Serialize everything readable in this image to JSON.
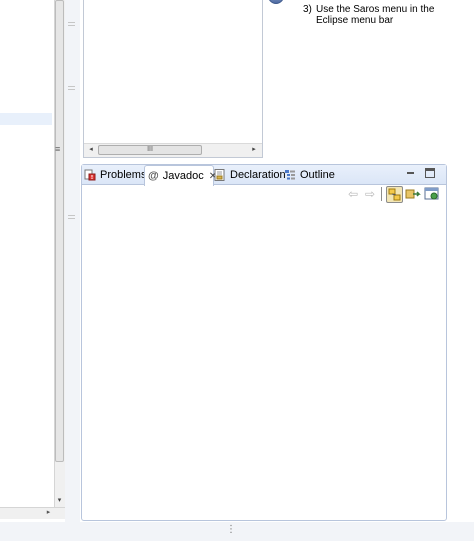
{
  "info": {
    "step_number": "3)",
    "step_text": "Use the Saros menu in the Eclipse menu bar"
  },
  "tabs": [
    {
      "label": "Problems",
      "icon": "problems-icon"
    },
    {
      "label": "Javadoc",
      "icon": "javadoc-icon",
      "active": true
    },
    {
      "label": "Declaration",
      "icon": "declaration-icon"
    },
    {
      "label": "Outline",
      "icon": "outline-icon"
    }
  ],
  "glyphs": {
    "scroll_left": "◂",
    "scroll_right": "▸",
    "scroll_down": "▾",
    "scroll_grip": "III",
    "vertical_grip": "≡",
    "tab_close": "✕",
    "javadoc_at": "@",
    "back": "⇦",
    "forward": "⇨",
    "bottom_grip": "⋮"
  },
  "colors": {
    "tab_bar_top": "#e9f0fb",
    "tab_bar_bottom": "#dbe6f7",
    "view_border": "#b8c5dc",
    "selection_highlight": "#e8f0fb"
  }
}
